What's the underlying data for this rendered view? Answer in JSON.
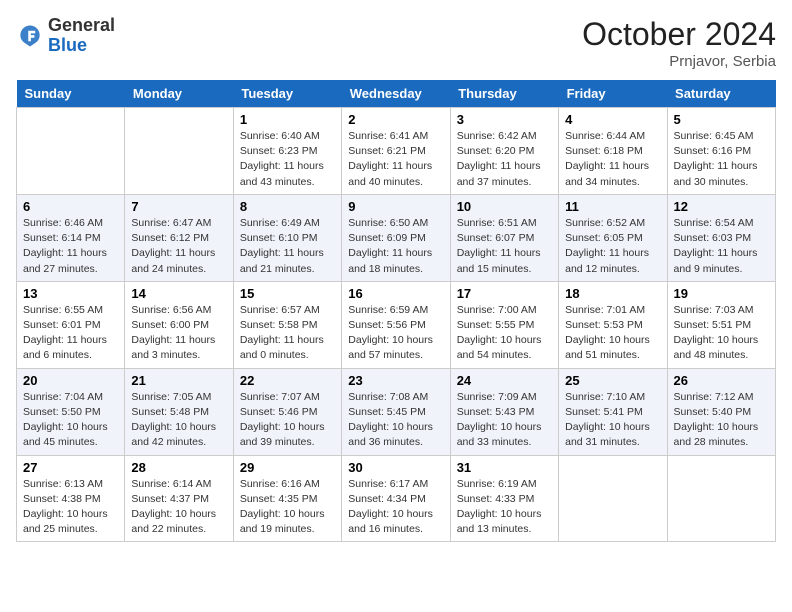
{
  "header": {
    "logo_general": "General",
    "logo_blue": "Blue",
    "month": "October 2024",
    "location": "Prnjavor, Serbia"
  },
  "weekdays": [
    "Sunday",
    "Monday",
    "Tuesday",
    "Wednesday",
    "Thursday",
    "Friday",
    "Saturday"
  ],
  "weeks": [
    [
      {
        "day": "",
        "sunrise": "",
        "sunset": "",
        "daylight": ""
      },
      {
        "day": "",
        "sunrise": "",
        "sunset": "",
        "daylight": ""
      },
      {
        "day": "1",
        "sunrise": "Sunrise: 6:40 AM",
        "sunset": "Sunset: 6:23 PM",
        "daylight": "Daylight: 11 hours and 43 minutes."
      },
      {
        "day": "2",
        "sunrise": "Sunrise: 6:41 AM",
        "sunset": "Sunset: 6:21 PM",
        "daylight": "Daylight: 11 hours and 40 minutes."
      },
      {
        "day": "3",
        "sunrise": "Sunrise: 6:42 AM",
        "sunset": "Sunset: 6:20 PM",
        "daylight": "Daylight: 11 hours and 37 minutes."
      },
      {
        "day": "4",
        "sunrise": "Sunrise: 6:44 AM",
        "sunset": "Sunset: 6:18 PM",
        "daylight": "Daylight: 11 hours and 34 minutes."
      },
      {
        "day": "5",
        "sunrise": "Sunrise: 6:45 AM",
        "sunset": "Sunset: 6:16 PM",
        "daylight": "Daylight: 11 hours and 30 minutes."
      }
    ],
    [
      {
        "day": "6",
        "sunrise": "Sunrise: 6:46 AM",
        "sunset": "Sunset: 6:14 PM",
        "daylight": "Daylight: 11 hours and 27 minutes."
      },
      {
        "day": "7",
        "sunrise": "Sunrise: 6:47 AM",
        "sunset": "Sunset: 6:12 PM",
        "daylight": "Daylight: 11 hours and 24 minutes."
      },
      {
        "day": "8",
        "sunrise": "Sunrise: 6:49 AM",
        "sunset": "Sunset: 6:10 PM",
        "daylight": "Daylight: 11 hours and 21 minutes."
      },
      {
        "day": "9",
        "sunrise": "Sunrise: 6:50 AM",
        "sunset": "Sunset: 6:09 PM",
        "daylight": "Daylight: 11 hours and 18 minutes."
      },
      {
        "day": "10",
        "sunrise": "Sunrise: 6:51 AM",
        "sunset": "Sunset: 6:07 PM",
        "daylight": "Daylight: 11 hours and 15 minutes."
      },
      {
        "day": "11",
        "sunrise": "Sunrise: 6:52 AM",
        "sunset": "Sunset: 6:05 PM",
        "daylight": "Daylight: 11 hours and 12 minutes."
      },
      {
        "day": "12",
        "sunrise": "Sunrise: 6:54 AM",
        "sunset": "Sunset: 6:03 PM",
        "daylight": "Daylight: 11 hours and 9 minutes."
      }
    ],
    [
      {
        "day": "13",
        "sunrise": "Sunrise: 6:55 AM",
        "sunset": "Sunset: 6:01 PM",
        "daylight": "Daylight: 11 hours and 6 minutes."
      },
      {
        "day": "14",
        "sunrise": "Sunrise: 6:56 AM",
        "sunset": "Sunset: 6:00 PM",
        "daylight": "Daylight: 11 hours and 3 minutes."
      },
      {
        "day": "15",
        "sunrise": "Sunrise: 6:57 AM",
        "sunset": "Sunset: 5:58 PM",
        "daylight": "Daylight: 11 hours and 0 minutes."
      },
      {
        "day": "16",
        "sunrise": "Sunrise: 6:59 AM",
        "sunset": "Sunset: 5:56 PM",
        "daylight": "Daylight: 10 hours and 57 minutes."
      },
      {
        "day": "17",
        "sunrise": "Sunrise: 7:00 AM",
        "sunset": "Sunset: 5:55 PM",
        "daylight": "Daylight: 10 hours and 54 minutes."
      },
      {
        "day": "18",
        "sunrise": "Sunrise: 7:01 AM",
        "sunset": "Sunset: 5:53 PM",
        "daylight": "Daylight: 10 hours and 51 minutes."
      },
      {
        "day": "19",
        "sunrise": "Sunrise: 7:03 AM",
        "sunset": "Sunset: 5:51 PM",
        "daylight": "Daylight: 10 hours and 48 minutes."
      }
    ],
    [
      {
        "day": "20",
        "sunrise": "Sunrise: 7:04 AM",
        "sunset": "Sunset: 5:50 PM",
        "daylight": "Daylight: 10 hours and 45 minutes."
      },
      {
        "day": "21",
        "sunrise": "Sunrise: 7:05 AM",
        "sunset": "Sunset: 5:48 PM",
        "daylight": "Daylight: 10 hours and 42 minutes."
      },
      {
        "day": "22",
        "sunrise": "Sunrise: 7:07 AM",
        "sunset": "Sunset: 5:46 PM",
        "daylight": "Daylight: 10 hours and 39 minutes."
      },
      {
        "day": "23",
        "sunrise": "Sunrise: 7:08 AM",
        "sunset": "Sunset: 5:45 PM",
        "daylight": "Daylight: 10 hours and 36 minutes."
      },
      {
        "day": "24",
        "sunrise": "Sunrise: 7:09 AM",
        "sunset": "Sunset: 5:43 PM",
        "daylight": "Daylight: 10 hours and 33 minutes."
      },
      {
        "day": "25",
        "sunrise": "Sunrise: 7:10 AM",
        "sunset": "Sunset: 5:41 PM",
        "daylight": "Daylight: 10 hours and 31 minutes."
      },
      {
        "day": "26",
        "sunrise": "Sunrise: 7:12 AM",
        "sunset": "Sunset: 5:40 PM",
        "daylight": "Daylight: 10 hours and 28 minutes."
      }
    ],
    [
      {
        "day": "27",
        "sunrise": "Sunrise: 6:13 AM",
        "sunset": "Sunset: 4:38 PM",
        "daylight": "Daylight: 10 hours and 25 minutes."
      },
      {
        "day": "28",
        "sunrise": "Sunrise: 6:14 AM",
        "sunset": "Sunset: 4:37 PM",
        "daylight": "Daylight: 10 hours and 22 minutes."
      },
      {
        "day": "29",
        "sunrise": "Sunrise: 6:16 AM",
        "sunset": "Sunset: 4:35 PM",
        "daylight": "Daylight: 10 hours and 19 minutes."
      },
      {
        "day": "30",
        "sunrise": "Sunrise: 6:17 AM",
        "sunset": "Sunset: 4:34 PM",
        "daylight": "Daylight: 10 hours and 16 minutes."
      },
      {
        "day": "31",
        "sunrise": "Sunrise: 6:19 AM",
        "sunset": "Sunset: 4:33 PM",
        "daylight": "Daylight: 10 hours and 13 minutes."
      },
      {
        "day": "",
        "sunrise": "",
        "sunset": "",
        "daylight": ""
      },
      {
        "day": "",
        "sunrise": "",
        "sunset": "",
        "daylight": ""
      }
    ]
  ]
}
